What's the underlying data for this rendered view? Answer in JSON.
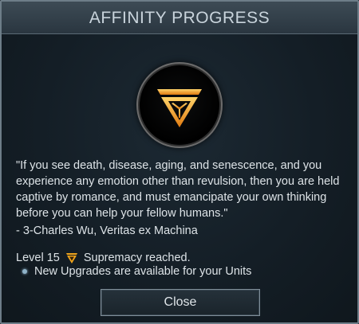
{
  "dialog": {
    "title": "AFFINITY PROGRESS",
    "emblem_icon": "supremacy-affinity-icon",
    "quote": "\"If you see death, disease, aging, and senescence, and you experience any emotion other than revulsion, then you are held captive by romance, and must emancipate your own thinking before you can help your fellow humans.\"",
    "attribution": "- 3-Charles Wu, Veritas ex Machina",
    "level_label": "Level 15",
    "level_text": "Supremacy reached.",
    "bullet_text": "New Upgrades are available for your Units",
    "close_label": "Close",
    "colors": {
      "accent_orange": "#f2a51c",
      "frame": "#6d7d88"
    }
  }
}
